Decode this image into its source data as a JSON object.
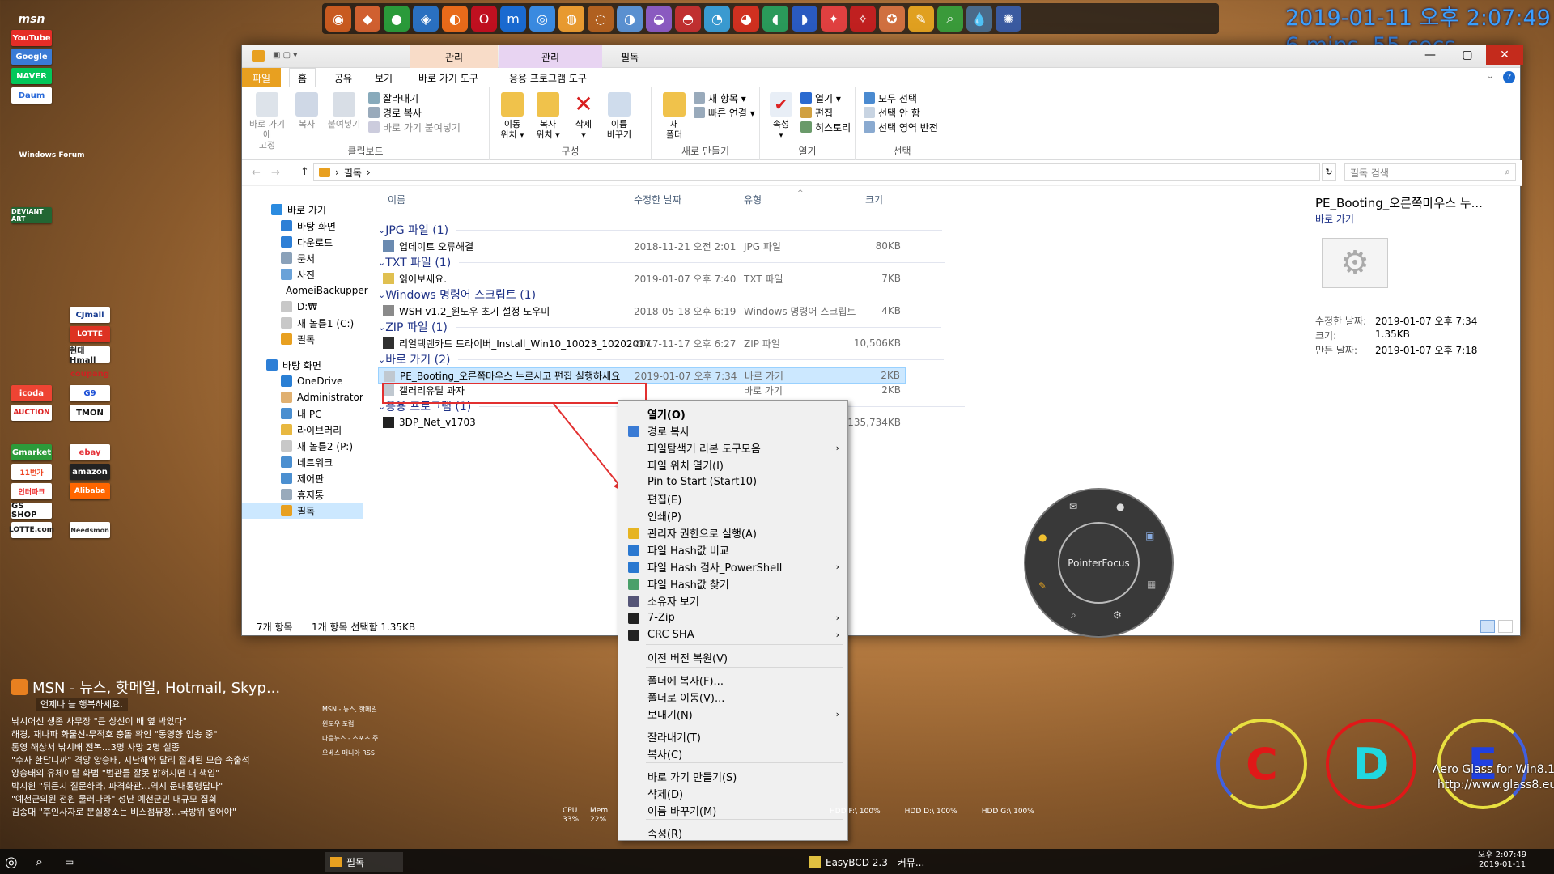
{
  "clock": {
    "datetime": "2019-01-11 오후 2:07:49",
    "uptime": "6 mins, 55 secs"
  },
  "window": {
    "context_tabs": [
      "관리",
      "관리"
    ],
    "title": "필독",
    "ribbon_tabs": [
      "파일",
      "홈",
      "공유",
      "보기",
      "바로 가기 도구",
      "응용 프로그램 도구"
    ],
    "clipboard": {
      "pin": "바로 가기에\n고정",
      "copy": "복사",
      "paste": "붙여넣기",
      "cut": "잘라내기",
      "copy_path": "경로 복사",
      "paste_shortcut": "바로 가기 붙여넣기",
      "label": "클립보드"
    },
    "organize": {
      "move": "이동\n위치 ▾",
      "copyto": "복사\n위치 ▾",
      "delete": "삭제\n▾",
      "rename": "이름\n바꾸기",
      "label": "구성"
    },
    "new": {
      "folder": "새\n폴더",
      "new_item": "새 항목 ▾",
      "easy_access": "빠른 연결 ▾",
      "label": "새로 만들기"
    },
    "open": {
      "props": "속성\n▾",
      "open": "열기 ▾",
      "edit": "편집",
      "history": "히스토리",
      "label": "열기"
    },
    "select": {
      "all": "모두 선택",
      "none": "선택 안 함",
      "invert": "선택 영역 반전",
      "label": "선택"
    },
    "address": "필독",
    "search_placeholder": "필독 검색",
    "nav": [
      {
        "label": "바로 가기",
        "color": "#2b8be0"
      },
      {
        "label": "바탕 화면",
        "color": "#2d7fd6"
      },
      {
        "label": "다운로드",
        "color": "#2d7fd6"
      },
      {
        "label": "문서",
        "color": "#8aa1b9"
      },
      {
        "label": "사진",
        "color": "#6aa2d8"
      },
      {
        "label": "AomeiBackupper",
        "color": "#f0c24b"
      },
      {
        "label": "D:₩",
        "color": "#c8c8c8"
      },
      {
        "label": "새 볼륨1 (C:)",
        "color": "#c8c8c8"
      },
      {
        "label": "필독",
        "color": "#e8a020"
      },
      {
        "label": "바탕 화면",
        "color": "#2d7fd6"
      },
      {
        "label": "OneDrive",
        "color": "#2a7fd4"
      },
      {
        "label": "Administrator",
        "color": "#e0b070"
      },
      {
        "label": "내 PC",
        "color": "#4b8fd0"
      },
      {
        "label": "라이브러리",
        "color": "#e8b840"
      },
      {
        "label": "새 볼륨2 (P:)",
        "color": "#c8c8c8"
      },
      {
        "label": "네트워크",
        "color": "#4b8fd0"
      },
      {
        "label": "제어판",
        "color": "#4b8fd0"
      },
      {
        "label": "휴지통",
        "color": "#9ab"
      },
      {
        "label": "필독",
        "color": "#e8a020"
      }
    ],
    "columns": {
      "name": "이름",
      "date": "수정한 날짜",
      "type": "유형",
      "size": "크기"
    },
    "groups": [
      "JPG 파일 (1)",
      "TXT 파일 (1)",
      "Windows 명령어 스크립트 (1)",
      "ZIP 파일 (1)",
      "바로 가기 (2)",
      "응용 프로그램 (1)"
    ],
    "files": [
      {
        "name": "업데이트 오류해결",
        "date": "2018-11-21 오전 2:01",
        "type": "JPG 파일",
        "size": "80KB"
      },
      {
        "name": "읽어보세요.",
        "date": "2019-01-07 오후 7:40",
        "type": "TXT 파일",
        "size": "7KB"
      },
      {
        "name": "WSH v1.2_윈도우 초기 설정 도우미",
        "date": "2018-05-18 오후 6:19",
        "type": "Windows 명령어 스크립트",
        "size": "4KB"
      },
      {
        "name": "리얼텍랜카드 드라이버_Install_Win10_10023_10202017",
        "date": "2017-11-17 오후 6:27",
        "type": "ZIP 파일",
        "size": "10,506KB"
      },
      {
        "name": "PE_Booting_오른쪽마우스 누르시고 편집 실행하세요",
        "date": "2019-01-07 오후 7:34",
        "type": "바로 가기",
        "size": "2KB"
      },
      {
        "name": "갤러리유틸 과자",
        "date": "",
        "type": "바로 가기",
        "size": "2KB"
      },
      {
        "name": "3DP_Net_v1703",
        "date": "",
        "type": "응용 프로그램",
        "size": "135,734KB"
      }
    ],
    "status": {
      "count": "7개 항목",
      "selected": "1개 항목 선택함 1.35KB"
    },
    "preview": {
      "name": "PE_Booting_오른쪽마우스 누...",
      "kind": "바로 가기",
      "modified_l": "수정한 날짜:",
      "modified": "2019-01-07 오후 7:34",
      "size_l": "크기:",
      "size": "1.35KB",
      "created_l": "만든 날짜:",
      "created": "2019-01-07 오후 7:18"
    }
  },
  "menu": [
    {
      "label": "열기(O)",
      "bold": true
    },
    {
      "label": "경로 복사",
      "icon": "#3a7bd5"
    },
    {
      "label": "파일탐색기 리본 도구모음",
      "sub": true
    },
    {
      "label": "파일 위치 열기(I)"
    },
    {
      "label": "Pin to Start (Start10)"
    },
    {
      "label": "편집(E)"
    },
    {
      "label": "인쇄(P)"
    },
    {
      "label": "관리자 권한으로 실행(A)",
      "icon": "#e6b422"
    },
    {
      "label": "파일 Hash값 비교",
      "icon": "#2a78d0"
    },
    {
      "label": "파일 Hash 검사_PowerShell",
      "icon": "#2a78d0",
      "sub": true
    },
    {
      "label": "파일 Hash값 찾기",
      "icon": "#4aa06a"
    },
    {
      "label": "소유자 보기",
      "icon": "#557"
    },
    {
      "label": "7-Zip",
      "icon": "#222",
      "sub": true
    },
    {
      "label": "CRC SHA",
      "icon": "#222",
      "sub": true
    },
    {
      "label": "이전 버전 복원(V)"
    },
    {
      "label": "폴더에 복사(F)..."
    },
    {
      "label": "폴더로 이동(V)..."
    },
    {
      "label": "보내기(N)",
      "sub": true
    },
    {
      "label": "잘라내기(T)"
    },
    {
      "label": "복사(C)"
    },
    {
      "label": "바로 가기 만들기(S)"
    },
    {
      "label": "삭제(D)"
    },
    {
      "label": "이름 바꾸기(M)"
    },
    {
      "label": "속성(R)"
    }
  ],
  "pointerfocus": "PointerFocus",
  "drives": [
    "C",
    "D",
    "E"
  ],
  "aero": {
    "line1": "Aero Glass for Win8.1",
    "line2": "http://www.glass8.eu"
  },
  "rss": {
    "title": "MSN - 뉴스, 핫메일, Hotmail, Skyp...",
    "banner": "언제나 늘 행복하세요.",
    "items": [
      "낚시어선 생존 사무장 \"큰 상선이 배 옆 박았다\"",
      "해경, 재나파 화물선-무적호 충돌 확인 \"동영향 업송 중\"",
      "통영 해상서 낚시배 전복…3명 사망 2명 실종",
      "\"수사 한답니까\" 격앙 양승태, 지난해와 달리 절제된 모습 속출석",
      "양승태의 유체이탈 화법 \"범관들 잘못 밝혀지면 내 책임\"",
      "박지원 \"뒤든지 질문하라, 파격화관…역시 문대통령답다\"",
      "\"예천군의원 전원 물러나라\" 성난 예천군민 대규모 집회",
      "김종대 \"후인사자로 분실장소는 비스점뮤장…국방위 열어야\""
    ],
    "side": [
      "MSN - 뉴스, 핫메일...",
      "윈도우 포럼",
      "다음뉴스 - 스포츠 주...",
      "오베스 매니아 RSS"
    ]
  },
  "meters": {
    "cpu_l": "CPU",
    "cpu": "33%",
    "mem_l": "Mem",
    "mem": "22%",
    "f": "HDD F:\\  100%",
    "d": "HDD D:\\  100%",
    "g": "HDD G:\\  100%"
  },
  "taskbar": {
    "explorer": "필독",
    "easybcd": "EasyBCD 2.3 - 커뮤...",
    "time": "오후 2:07:49",
    "date": "2019-01-11"
  },
  "desktop_left": [
    "msn",
    "YouTube",
    "Google",
    "NAVER",
    "Daum",
    "Windows Forum",
    "DEVIANT ART",
    "CJmall",
    "LOTTE",
    "현대Hmall",
    "coupang",
    "icoda",
    "G9",
    "AUCTION",
    "TMON",
    "Gmarket",
    "ebay",
    "amazon",
    "11번가",
    "Alibaba",
    "인터파크",
    "GS SHOP",
    "LOTTE.com",
    "Needsmon"
  ]
}
